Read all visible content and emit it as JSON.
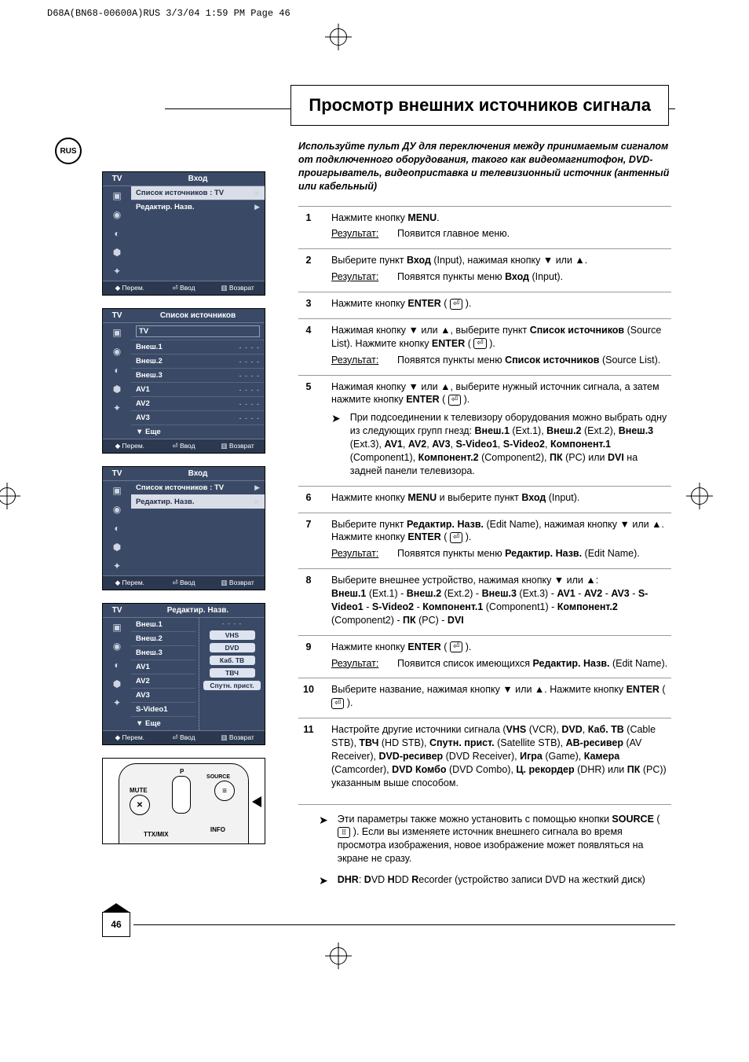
{
  "slug": "D68A(BN68-00600A)RUS  3/3/04 1:59 PM  Page 46",
  "lang_badge": "RUS",
  "title": "Просмотр внешних источников сигнала",
  "page_number": "46",
  "osd": {
    "footer": {
      "move": "Перем.",
      "enter": "Ввод",
      "return": "Возврат"
    },
    "panels": [
      {
        "tv": "TV",
        "title": "Вход",
        "rows": [
          {
            "label": "Список источников : TV",
            "chev": "▶",
            "hi": true
          },
          {
            "label": "Редактир. Назв.",
            "chev": "▶"
          }
        ]
      },
      {
        "tv": "TV",
        "title": "Список источников",
        "rows": [
          {
            "label": "TV",
            "box": true
          },
          {
            "label": "Внеш.1",
            "val": "- - - -"
          },
          {
            "label": "Внеш.2",
            "val": "- - - -"
          },
          {
            "label": "Внеш.3",
            "val": "- - - -"
          },
          {
            "label": "AV1",
            "val": "- - - -"
          },
          {
            "label": "AV2",
            "val": "- - - -"
          },
          {
            "label": "AV3",
            "val": "- - - -"
          },
          {
            "label": "▼ Еще"
          }
        ]
      },
      {
        "tv": "TV",
        "title": "Вход",
        "rows": [
          {
            "label": "Список источников : TV",
            "chev": "▶"
          },
          {
            "label": "Редактир. Назв.",
            "chev": "▶",
            "hi": true
          }
        ]
      },
      {
        "tv": "TV",
        "title": "Редактир. Назв.",
        "rows": [
          {
            "label": "Внеш.1"
          },
          {
            "label": "Внеш.2"
          },
          {
            "label": "Внеш.3"
          },
          {
            "label": "AV1"
          },
          {
            "label": "AV2"
          },
          {
            "label": "AV3"
          },
          {
            "label": "S-Video1"
          },
          {
            "label": "▼ Еще"
          }
        ],
        "names": [
          "- - - -",
          "VHS",
          "DVD",
          "Каб. ТВ",
          "ТВЧ",
          "Спутн. прист."
        ]
      }
    ]
  },
  "remote": {
    "mute": "MUTE",
    "p": "P",
    "source": "SOURCE",
    "ttx": "TTX/MIX",
    "info": "INFO"
  },
  "intro": "Используйте пульт ДУ для переключения между принимаемым сигналом от подключенного оборудования, такого как видеомагнитофон, DVD-проигрыватель, видеоприставка и телевизионный источник (антенный или кабельный)",
  "labels": {
    "result": "Результат:"
  },
  "steps": [
    {
      "n": "1",
      "body_html": "Нажмите кнопку <b>MENU</b>.",
      "result": "Появится главное меню."
    },
    {
      "n": "2",
      "body_html": "Выберите пункт <b>Вход</b> (Input), нажимая кнопку ▼ или ▲.",
      "result": "Появятся пункты меню <b>Вход</b> (Input)."
    },
    {
      "n": "3",
      "body_html": "Нажмите кнопку <b>ENTER</b> ( <span class='enter-ic'>⏎</span> )."
    },
    {
      "n": "4",
      "body_html": "Нажимая кнопку ▼ или ▲, выберите пункт <b>Список источников</b> (Source List). Нажмите кнопку <b>ENTER</b> ( <span class='enter-ic'>⏎</span> ).",
      "result": "Появятся пункты меню <b>Список источников</b> (Source List)."
    },
    {
      "n": "5",
      "body_html": "Нажимая кнопку ▼ или ▲, выберите нужный источник сигнала, а затем нажмите кнопку <b>ENTER</b> ( <span class='enter-ic'>⏎</span> ).",
      "note_html": "При подсоединении к телевизору оборудования можно выбрать одну из следующих групп гнезд: <b>Внеш.1</b> (Ext.1), <b>Внеш.2</b> (Ext.2), <b>Внеш.3</b> (Ext.3), <b>AV1</b>, <b>AV2</b>, <b>AV3</b>, <b>S-Video1</b>, <b>S-Video2</b>, <b>Компонент.1</b> (Component1), <b>Компонент.2</b> (Component2), <b>ПК</b> (PC) или <b>DVI</b> на задней панели телевизора."
    },
    {
      "n": "6",
      "body_html": "Нажмите кнопку <b>MENU</b> и выберите пункт <b>Вход</b> (Input)."
    },
    {
      "n": "7",
      "body_html": "Выберите пункт <b>Редактир. Назв.</b> (Edit Name), нажимая кнопку ▼ или ▲. Нажмите кнопку <b>ENTER</b> ( <span class='enter-ic'>⏎</span> ).",
      "result": "Появятся пункты меню <b>Редактир. Назв.</b> (Edit Name)."
    },
    {
      "n": "8",
      "body_html": "Выберите внешнее устройство, нажимая кнопку ▼ или ▲:<br><b>Внеш.1</b> (Ext.1) - <b>Внеш.2</b> (Ext.2) - <b>Внеш.3</b> (Ext.3) - <b>AV1</b> - <b>AV2</b> - <b>AV3</b> - <b>S-Video1</b> - <b>S-Video2</b> - <b>Компонент.1</b> (Component1) - <b>Компонент.2</b> (Component2) - <b>ПК</b> (PC) - <b>DVI</b>"
    },
    {
      "n": "9",
      "body_html": "Нажмите кнопку <b>ENTER</b> ( <span class='enter-ic'>⏎</span> ).",
      "result": "Появится список имеющихся <b>Редактир. Назв.</b> (Edit Name)."
    },
    {
      "n": "10",
      "body_html": "Выберите название, нажимая кнопку ▼ или ▲. Нажмите кнопку <b>ENTER</b> ( <span class='enter-ic'>⏎</span> )."
    },
    {
      "n": "11",
      "body_html": "Настройте другие источники сигнала (<b>VHS</b> (VCR), <b>DVD</b>, <b>Каб. ТВ</b> (Cable STB), <b>ТВЧ</b> (HD STB), <b>Спутн. прист.</b> (Satellite STB), <b>АВ-ресивер</b> (AV Receiver), <b>DVD-ресивер</b> (DVD Receiver), <b>Игра</b> (Game), <b>Камера</b> (Camcorder), <b>DVD Комбо</b> (DVD Combo), <b>Ц. рекордер</b> (DHR) или <b>ПК</b> (PC)) указанным выше способом."
    }
  ],
  "footnotes": [
    "Эти параметры также можно установить с помощью кнопки <b>SOURCE</b> ( <span class='src-ic'>⠿</span> ). Если вы изменяете источник внешнего сигнала во время просмотра изображения, новое изображение может появляться на экране не сразу.",
    "<b>DHR</b>: <b>D</b>VD <b>H</b>DD <b>R</b>ecorder (устройство записи DVD на жесткий диск)"
  ]
}
